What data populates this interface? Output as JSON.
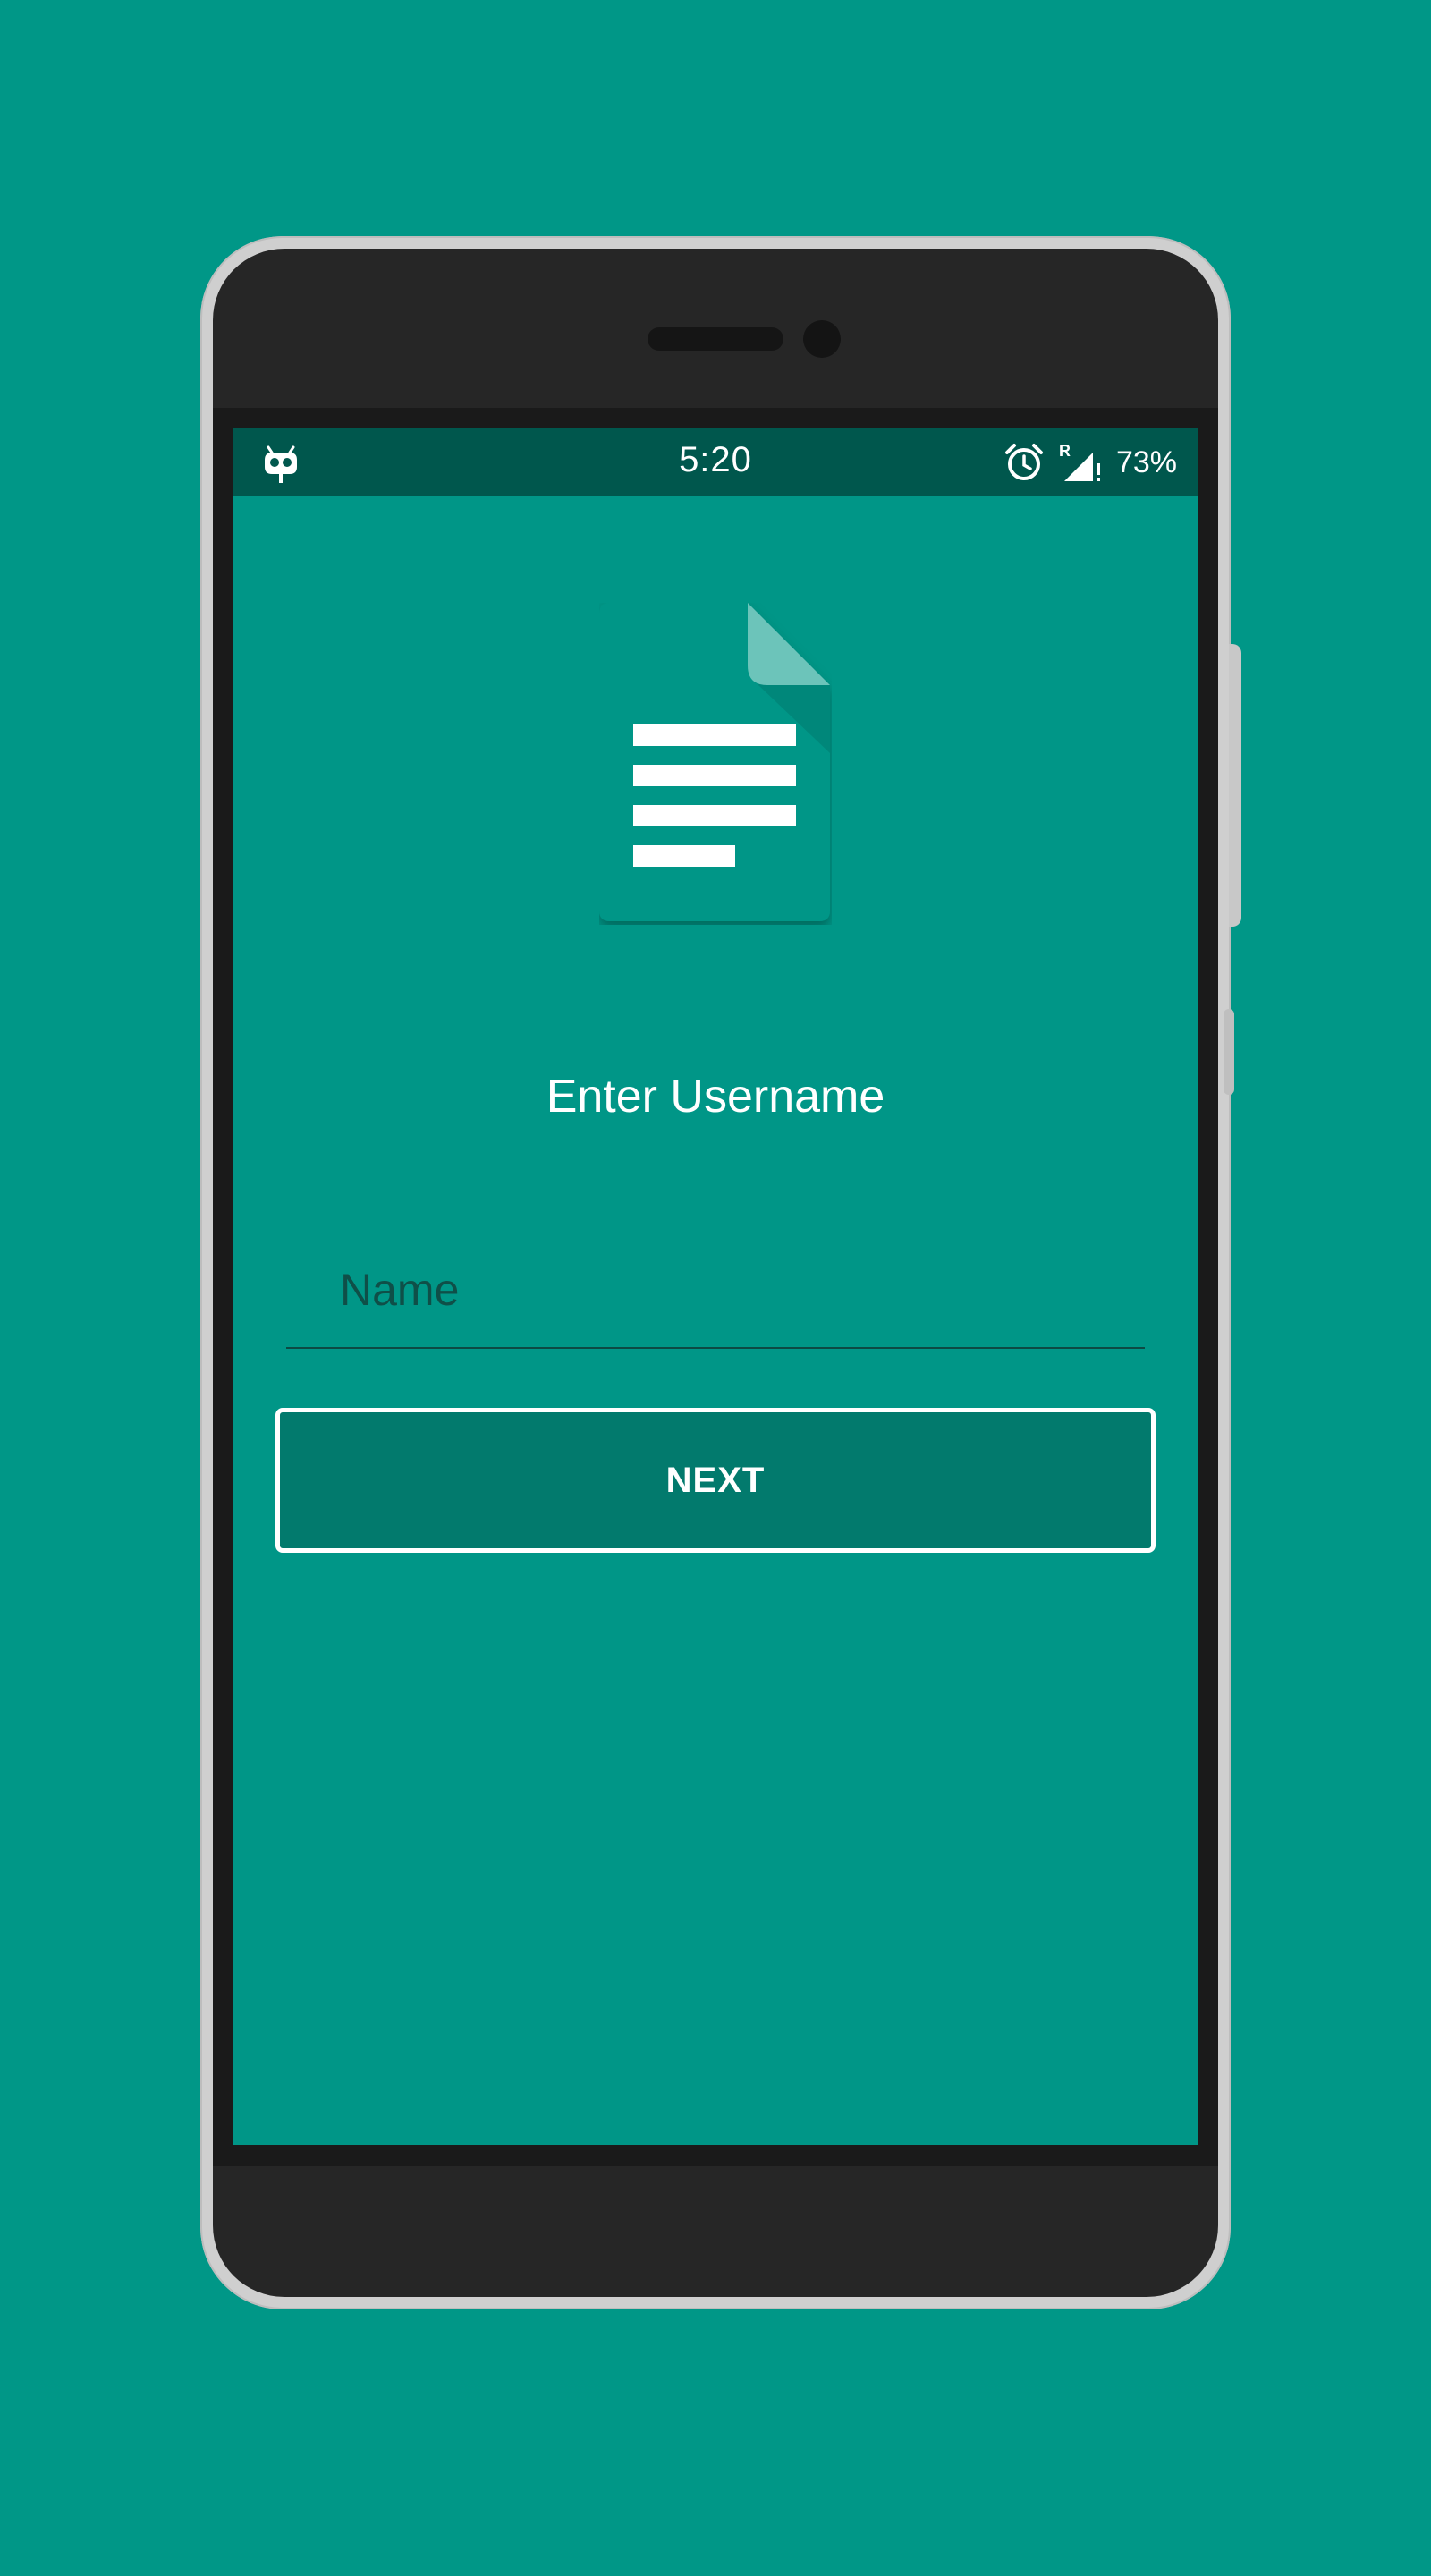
{
  "status_bar": {
    "time": "5:20",
    "battery": "73%",
    "left_icon": "cyanogenmod-bot-icon",
    "alarm_icon": "alarm-clock-icon",
    "signal_icon": "signal-roaming-icon",
    "roaming_label": "R"
  },
  "app": {
    "logo_icon": "document-icon",
    "title": "Enter Username",
    "name_placeholder": "Name",
    "name_value": "",
    "next_label": "NEXT"
  },
  "colors": {
    "background": "#009787",
    "status_bar": "#00574d",
    "button_fill": "#027a6d",
    "button_border": "#ffffff",
    "text_primary": "#ffffff",
    "input_text": "#0d4a44"
  }
}
